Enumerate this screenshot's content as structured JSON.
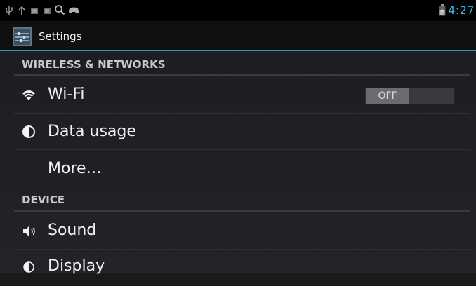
{
  "status_bar": {
    "time": "4:27",
    "icons": [
      "usb-icon",
      "upload-icon",
      "notification-icon",
      "notification-icon",
      "search-icon",
      "game-controller-icon",
      "battery-icon"
    ],
    "accent_color": "#33b5e5"
  },
  "action_bar": {
    "title": "Settings",
    "icon": "settings-app-icon"
  },
  "sections": [
    {
      "header": "WIRELESS & NETWORKS",
      "items": [
        {
          "label": "Wi-Fi",
          "icon": "wifi-icon",
          "toggle": "OFF"
        },
        {
          "label": "Data usage",
          "icon": "data-usage-icon"
        },
        {
          "label": "More…"
        }
      ]
    },
    {
      "header": "DEVICE",
      "items": [
        {
          "label": "Sound",
          "icon": "sound-icon"
        },
        {
          "label": "Display",
          "icon": "display-icon"
        }
      ]
    }
  ]
}
